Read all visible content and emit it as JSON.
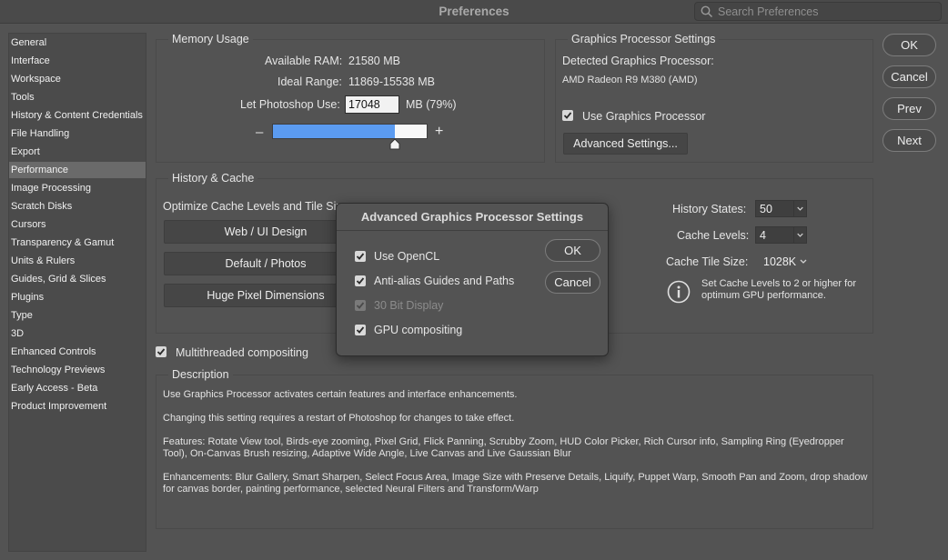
{
  "window": {
    "title": "Preferences"
  },
  "search": {
    "placeholder": "Search Preferences"
  },
  "sidebar": {
    "items": [
      {
        "label": "General"
      },
      {
        "label": "Interface"
      },
      {
        "label": "Workspace"
      },
      {
        "label": "Tools"
      },
      {
        "label": "History & Content Credentials"
      },
      {
        "label": "File Handling"
      },
      {
        "label": "Export"
      },
      {
        "label": "Performance",
        "active": true
      },
      {
        "label": "Image Processing"
      },
      {
        "label": "Scratch Disks"
      },
      {
        "label": "Cursors"
      },
      {
        "label": "Transparency & Gamut"
      },
      {
        "label": "Units & Rulers"
      },
      {
        "label": "Guides, Grid & Slices"
      },
      {
        "label": "Plugins"
      },
      {
        "label": "Type"
      },
      {
        "label": "3D"
      },
      {
        "label": "Enhanced Controls"
      },
      {
        "label": "Technology Previews"
      },
      {
        "label": "Early Access - Beta"
      },
      {
        "label": "Product Improvement"
      }
    ]
  },
  "memory": {
    "title": "Memory Usage",
    "available_label": "Available RAM:",
    "available_value": "21580 MB",
    "ideal_label": "Ideal Range:",
    "ideal_value": "11869-15538 MB",
    "let_label": "Let Photoshop Use:",
    "let_value": "17048",
    "let_unit": "MB (79%)",
    "slider_fraction": 0.79,
    "minus": "–",
    "plus": "+"
  },
  "gpu": {
    "title": "Graphics Processor Settings",
    "detected_label": "Detected Graphics Processor:",
    "detected_value": "AMD Radeon R9 M380 (AMD)",
    "use_label": "Use Graphics Processor",
    "use_checked": true,
    "advanced_button": "Advanced Settings..."
  },
  "history": {
    "title": "History & Cache",
    "optimize_label": "Optimize Cache Levels and Tile Size:",
    "buttons": [
      "Web / UI Design",
      "Default / Photos",
      "Huge Pixel Dimensions"
    ],
    "history_states_label": "History States:",
    "history_states_value": "50",
    "cache_levels_label": "Cache Levels:",
    "cache_levels_value": "4",
    "cache_tile_label": "Cache Tile Size:",
    "cache_tile_value": "1028K",
    "info_text": "Set Cache Levels to 2 or higher for optimum GPU performance."
  },
  "multithreaded": {
    "label": "Multithreaded compositing",
    "checked": true
  },
  "description": {
    "title": "Description",
    "p1": "Use Graphics Processor activates certain features and interface enhancements.",
    "p2": "Changing this setting requires a restart of Photoshop for changes to take effect.",
    "p3": "Features: Rotate View tool, Birds-eye zooming, Pixel Grid, Flick Panning, Scrubby Zoom, HUD Color Picker, Rich Cursor info, Sampling Ring (Eyedropper Tool), On-Canvas Brush resizing, Adaptive Wide Angle, Live Canvas and Live Gaussian Blur",
    "p4": "Enhancements: Blur Gallery, Smart Sharpen, Select Focus Area, Image Size with Preserve Details, Liquify, Puppet Warp, Smooth Pan and Zoom, drop shadow for canvas border, painting performance, selected Neural Filters and Transform/Warp"
  },
  "right_buttons": {
    "ok": "OK",
    "cancel": "Cancel",
    "prev": "Prev",
    "next": "Next"
  },
  "dialog": {
    "title": "Advanced Graphics Processor Settings",
    "options": [
      {
        "label": "Use OpenCL",
        "checked": true,
        "disabled": false
      },
      {
        "label": "Anti-alias Guides and Paths",
        "checked": true,
        "disabled": false
      },
      {
        "label": "30 Bit Display",
        "checked": true,
        "disabled": true
      },
      {
        "label": "GPU compositing",
        "checked": true,
        "disabled": false
      }
    ],
    "ok": "OK",
    "cancel": "Cancel"
  },
  "colors": {
    "accent_slider": "#5b9bf0",
    "background": "#535353"
  }
}
